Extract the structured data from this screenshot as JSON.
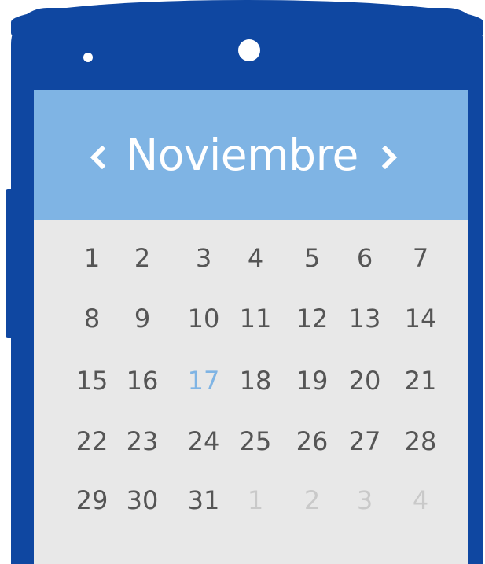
{
  "header": {
    "month": "Noviembre",
    "prev_icon": "chevron-left-icon",
    "next_icon": "chevron-right-icon"
  },
  "colors": {
    "device": "#0f47a1",
    "header": "#7fb4e4",
    "screen": "#e8e8e8",
    "day_text": "#555555",
    "today_text": "#7fb4e4",
    "other_month_text": "#c9c9c9"
  },
  "calendar": {
    "selected_day": "17",
    "weeks": [
      [
        {
          "label": "1",
          "state": "current"
        },
        {
          "label": "2",
          "state": "current"
        },
        {
          "label": "3",
          "state": "current"
        },
        {
          "label": "4",
          "state": "current"
        },
        {
          "label": "5",
          "state": "current"
        },
        {
          "label": "6",
          "state": "current"
        },
        {
          "label": "7",
          "state": "current"
        }
      ],
      [
        {
          "label": "8",
          "state": "current"
        },
        {
          "label": "9",
          "state": "current"
        },
        {
          "label": "10",
          "state": "current"
        },
        {
          "label": "11",
          "state": "current"
        },
        {
          "label": "12",
          "state": "current"
        },
        {
          "label": "13",
          "state": "current"
        },
        {
          "label": "14",
          "state": "current"
        }
      ],
      [
        {
          "label": "15",
          "state": "current"
        },
        {
          "label": "16",
          "state": "current"
        },
        {
          "label": "17",
          "state": "today"
        },
        {
          "label": "18",
          "state": "current"
        },
        {
          "label": "19",
          "state": "current"
        },
        {
          "label": "20",
          "state": "current"
        },
        {
          "label": "21",
          "state": "current"
        }
      ],
      [
        {
          "label": "22",
          "state": "current"
        },
        {
          "label": "23",
          "state": "current"
        },
        {
          "label": "24",
          "state": "current"
        },
        {
          "label": "25",
          "state": "current"
        },
        {
          "label": "26",
          "state": "current"
        },
        {
          "label": "27",
          "state": "current"
        },
        {
          "label": "28",
          "state": "current"
        }
      ],
      [
        {
          "label": "29",
          "state": "current"
        },
        {
          "label": "30",
          "state": "current"
        },
        {
          "label": "31",
          "state": "current"
        },
        {
          "label": "1",
          "state": "other"
        },
        {
          "label": "2",
          "state": "other"
        },
        {
          "label": "3",
          "state": "other"
        },
        {
          "label": "4",
          "state": "other"
        }
      ]
    ]
  }
}
